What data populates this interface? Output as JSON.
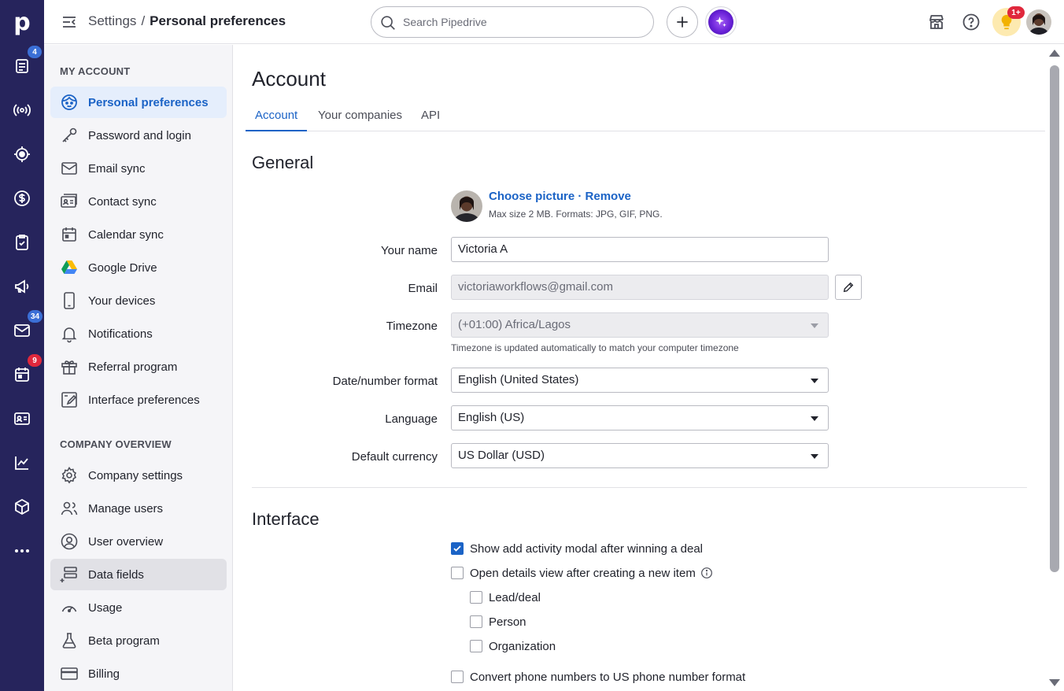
{
  "rail": {
    "logo": "p",
    "badges": {
      "deals": "4",
      "mail": "34",
      "calendar": "9"
    },
    "icons": [
      "deals-icon",
      "leads-icon",
      "target-icon",
      "money-icon",
      "tasks-icon",
      "campaigns-icon",
      "mail-icon",
      "calendar-icon",
      "contacts-icon",
      "insights-icon",
      "products-icon",
      "more-icon"
    ]
  },
  "topbar": {
    "breadcrumb_root": "Settings",
    "breadcrumb_sep": "/",
    "breadcrumb_current": "Personal preferences",
    "search_placeholder": "Search Pipedrive",
    "notification_badge": "1+"
  },
  "sidebar": {
    "my_account_heading": "MY ACCOUNT",
    "company_heading": "COMPANY OVERVIEW",
    "my_account_items": [
      {
        "label": "Personal preferences"
      },
      {
        "label": "Password and login"
      },
      {
        "label": "Email sync"
      },
      {
        "label": "Contact sync"
      },
      {
        "label": "Calendar sync"
      },
      {
        "label": "Google Drive"
      },
      {
        "label": "Your devices"
      },
      {
        "label": "Notifications"
      },
      {
        "label": "Referral program"
      },
      {
        "label": "Interface preferences"
      }
    ],
    "company_items": [
      {
        "label": "Company settings"
      },
      {
        "label": "Manage users"
      },
      {
        "label": "User overview"
      },
      {
        "label": "Data fields"
      },
      {
        "label": "Usage"
      },
      {
        "label": "Beta program"
      },
      {
        "label": "Billing"
      }
    ]
  },
  "main": {
    "title": "Account",
    "tabs": [
      {
        "label": "Account"
      },
      {
        "label": "Your companies"
      },
      {
        "label": "API"
      }
    ],
    "general_title": "General",
    "picture": {
      "choose": "Choose picture",
      "sep": "·",
      "remove": "Remove",
      "hint": "Max size 2 MB. Formats: JPG, GIF, PNG."
    },
    "fields": {
      "name_label": "Your name",
      "name_value": "Victoria A",
      "email_label": "Email",
      "email_value": "victoriaworkflows@gmail.com",
      "timezone_label": "Timezone",
      "timezone_value": "(+01:00) Africa/Lagos",
      "timezone_hint": "Timezone is updated automatically to match your computer timezone",
      "date_label": "Date/number format",
      "date_value": "English (United States)",
      "language_label": "Language",
      "language_value": "English (US)",
      "currency_label": "Default currency",
      "currency_value": "US Dollar (USD)"
    },
    "interface_title": "Interface",
    "options": {
      "show_activity": "Show add activity modal after winning a deal",
      "open_details": "Open details view after creating a new item",
      "lead_deal": "Lead/deal",
      "person": "Person",
      "organization": "Organization",
      "convert_phone": "Convert phone numbers to US phone number format"
    }
  },
  "colors": {
    "rail": "#26245c",
    "accent": "#1b63c6",
    "active_bg": "#e5eefc"
  }
}
